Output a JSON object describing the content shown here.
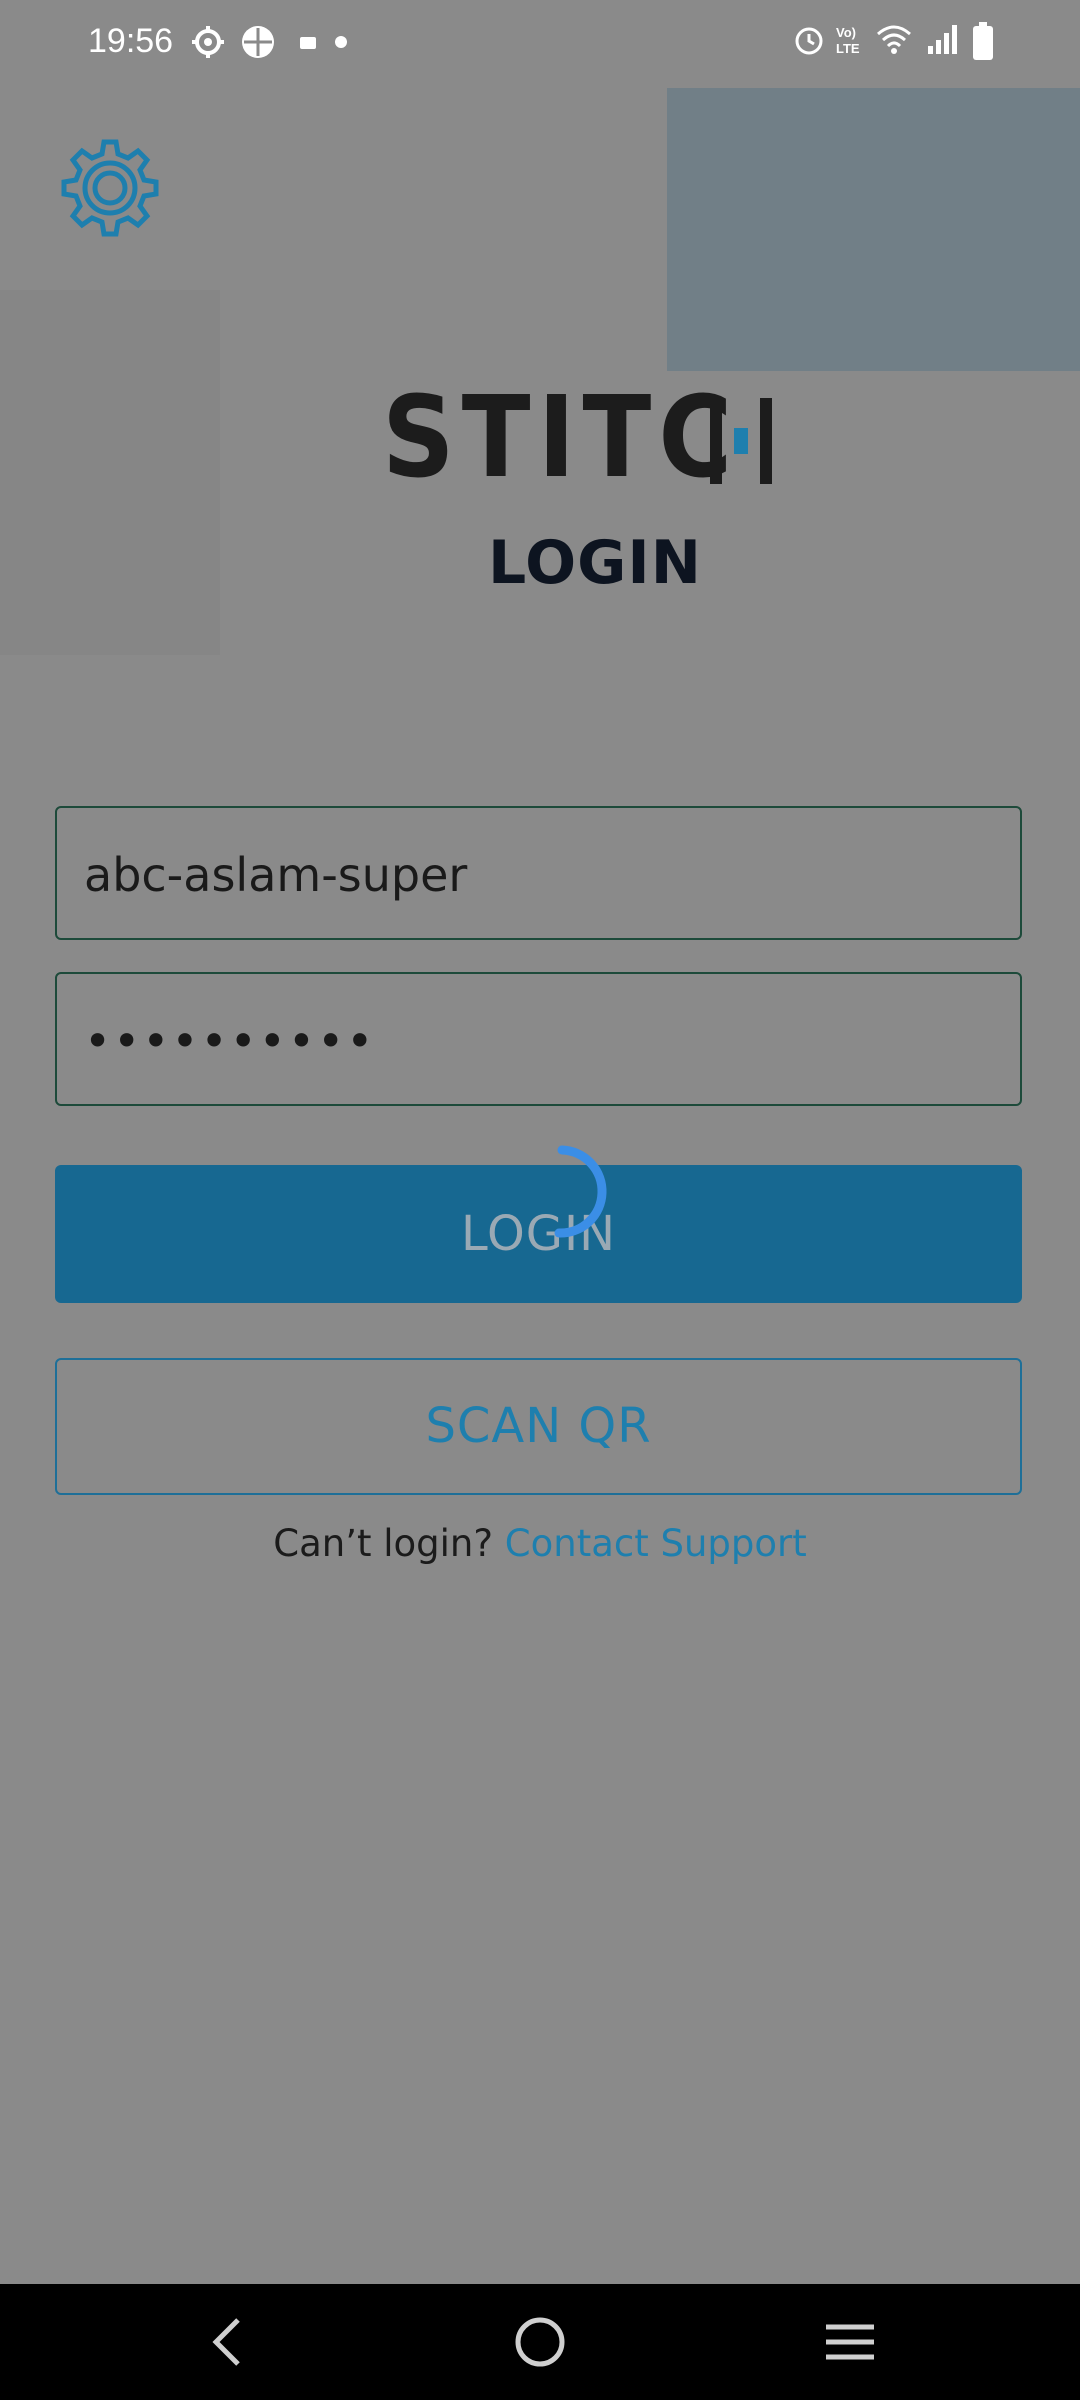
{
  "status_bar": {
    "time": "19:56",
    "left_icons": [
      "settings-gear-icon",
      "app-icon",
      "video-icon",
      "dot-icon"
    ],
    "right_icons": [
      "alarm-icon",
      "volte-icon",
      "wifi-icon",
      "signal-icon",
      "battery-icon"
    ]
  },
  "settings": {
    "icon": "gear-icon"
  },
  "logo": {
    "text": "STITC",
    "accent_color": "#1e7fae",
    "text_color": "#1c1c1c"
  },
  "login_form": {
    "title": "LOGIN",
    "username_value": "abc-aslam-super",
    "password_value": "••••••••••",
    "login_button_label": "LOGIN",
    "scan_button_label": "SCAN QR",
    "support_prefix": "Can’t login?",
    "support_link": "Contact Support"
  },
  "loading": {
    "spinner_color": "#3b8ee6"
  },
  "nav_bar": {
    "buttons": [
      "back-icon",
      "home-icon",
      "recents-icon"
    ]
  }
}
